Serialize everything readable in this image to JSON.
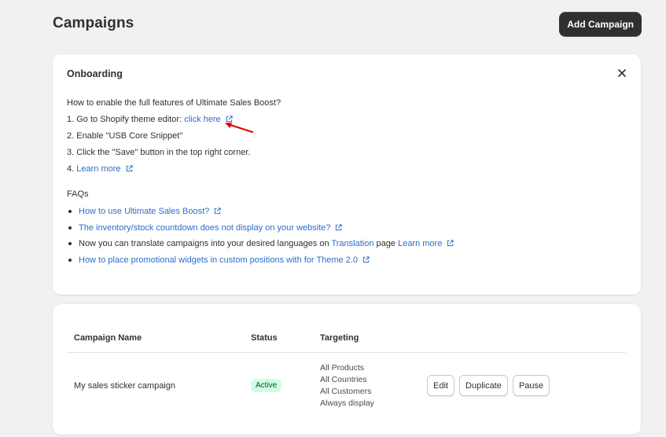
{
  "page": {
    "title": "Campaigns",
    "add_button": "Add Campaign"
  },
  "onboarding": {
    "title": "Onboarding",
    "intro": "How to enable the full features of Ultimate Sales Boost?",
    "steps": {
      "s1_text": "1. Go to Shopify theme editor:",
      "s1_link": "click here",
      "s2_text": "2. Enable \"USB Core Snippet\"",
      "s3_text": "3. Click the \"Save\" button in the top right corner.",
      "s4_text": "4.",
      "s4_link": "Learn more"
    },
    "faqs_title": "FAQs",
    "faqs": {
      "f1_link": "How to use Ultimate Sales Boost?",
      "f2_link": "The inventory/stock countdown does not display on your website?",
      "f3_pre": "Now you can translate campaigns into your desired languages on",
      "f3_link1": "Translation",
      "f3_mid": "page",
      "f3_link2": "Learn more",
      "f4_link": "How to place promotional widgets in custom positions with for Theme 2.0"
    }
  },
  "table": {
    "headers": {
      "name": "Campaign Name",
      "status": "Status",
      "targeting": "Targeting"
    },
    "rows": [
      {
        "name": "My sales sticker campaign",
        "status": "Active",
        "targeting": [
          "All Products",
          "All Countries",
          "All Customers",
          "Always display"
        ],
        "actions": {
          "edit": "Edit",
          "duplicate": "Duplicate",
          "pause": "Pause"
        }
      }
    ]
  },
  "colors": {
    "link": "#2c6ecb",
    "primary_button": "#303030",
    "badge_bg": "#cdfee1",
    "arrow": "#e00000"
  }
}
